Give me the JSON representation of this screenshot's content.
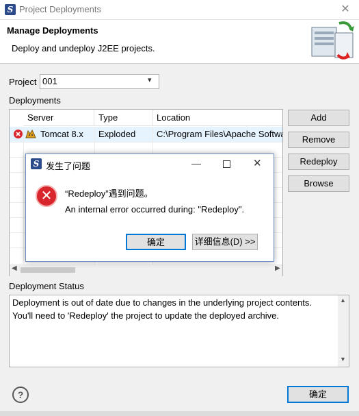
{
  "window": {
    "title": "Project Deployments",
    "close_glyph": "✕"
  },
  "header": {
    "title": "Manage Deployments",
    "description": "Deploy and undeploy J2EE projects."
  },
  "project": {
    "label": "Project",
    "value": "001"
  },
  "deployments": {
    "label": "Deployments",
    "columns": [
      "Server",
      "Type",
      "Location"
    ],
    "rows": [
      {
        "server": "Tomcat  8.x",
        "type": "Exploded",
        "location": "C:\\Program Files\\Apache Softwa"
      }
    ]
  },
  "buttons": {
    "add": "Add",
    "remove": "Remove",
    "redeploy": "Redeploy",
    "browse": "Browse",
    "ok": "确定"
  },
  "status": {
    "label": "Deployment Status",
    "line1": "Deployment is out of date due to changes in the underlying project contents.",
    "line2": "You'll need to 'Redeploy' the project to update the deployed archive."
  },
  "dialog": {
    "title": "发生了问题",
    "message1": "“Redeploy”遇到问题。",
    "message2": "An internal error occurred during: \"Redeploy\".",
    "ok_label": "确定",
    "details_label": "详细信息(D) >>"
  },
  "colors": {
    "accent": "#0078d7",
    "error": "#d9262c",
    "selection": "#e5f3ff"
  },
  "icons": {
    "app": "eclipse-s-icon",
    "error": "error-x-icon",
    "help": "help-question-icon",
    "tomcat": "tomcat-cat-icon"
  }
}
